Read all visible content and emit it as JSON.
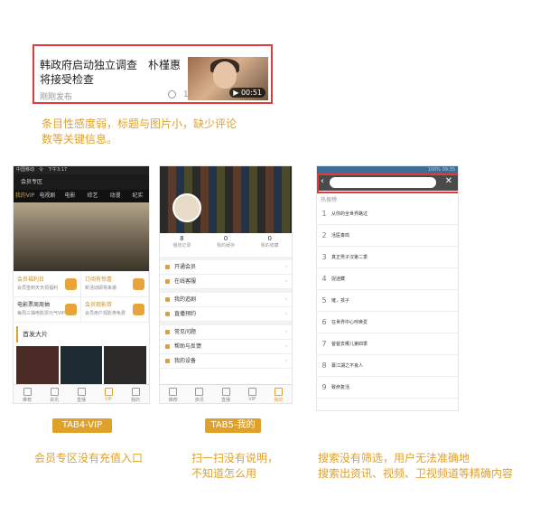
{
  "news": {
    "title": "韩政府启动独立调查　朴槿惠将接受检查",
    "time": "刚刚发布",
    "count": "1331",
    "duration": "00:51"
  },
  "note_top": [
    "条目性感度弱，标题与图片小，缺少评论",
    "数等关键信息。"
  ],
  "panel1": {
    "status": "中国移动　令　下午3:17",
    "title": "会员专区",
    "tabs": [
      "我的VIP",
      "电视剧",
      "电影",
      "综艺",
      "动漫",
      "纪实"
    ],
    "cells": [
      {
        "t": "会员福利日",
        "s": "会员签到天天领福利"
      },
      {
        "t": "订阅有惊喜",
        "s": "新活动即将来袭"
      },
      {
        "t": "电影票周周抽",
        "s": "每周三抽电影票元气VIP"
      },
      {
        "t": "会员观影券",
        "s": "会员用户观影券免费"
      }
    ],
    "section": "首发大片",
    "tabbar": [
      "推荐",
      "资讯",
      "直播",
      "VIP",
      "我的"
    ]
  },
  "panel2": {
    "stats": [
      {
        "n": "8",
        "l": "播放记录"
      },
      {
        "n": "0",
        "l": "我的缓存"
      },
      {
        "n": "0",
        "l": "我的收藏"
      }
    ],
    "rows": [
      "开通会员",
      "在线客服",
      "我的追剧",
      "直播预约",
      "常见问题",
      "帮助与反馈",
      "我的设备"
    ],
    "tabbar": [
      "推荐",
      "资讯",
      "直播",
      "VIP",
      "我的"
    ]
  },
  "panel3": {
    "status": "100% 09:35",
    "hot": "热搜榜",
    "items": [
      "从你的全世界路过",
      "活医奏鸣",
      "真正男子汉第二季",
      "捉迷藏",
      "璀，孩子",
      "在世界中心呼唤爱",
      "爸爸去哪儿第四季",
      "幕江湖之不良人",
      "致命复活"
    ]
  },
  "captions": {
    "p1": "TAB4-VIP",
    "p2": "TAB5-我的"
  },
  "notes_bottom": {
    "p1": "会员专区没有充值入口",
    "p2": [
      "扫一扫没有说明，",
      "不知道怎么用"
    ],
    "p3": [
      "搜索没有筛选，用户无法准确地",
      "搜索出资讯、视频、卫视频道等精确内容"
    ]
  }
}
